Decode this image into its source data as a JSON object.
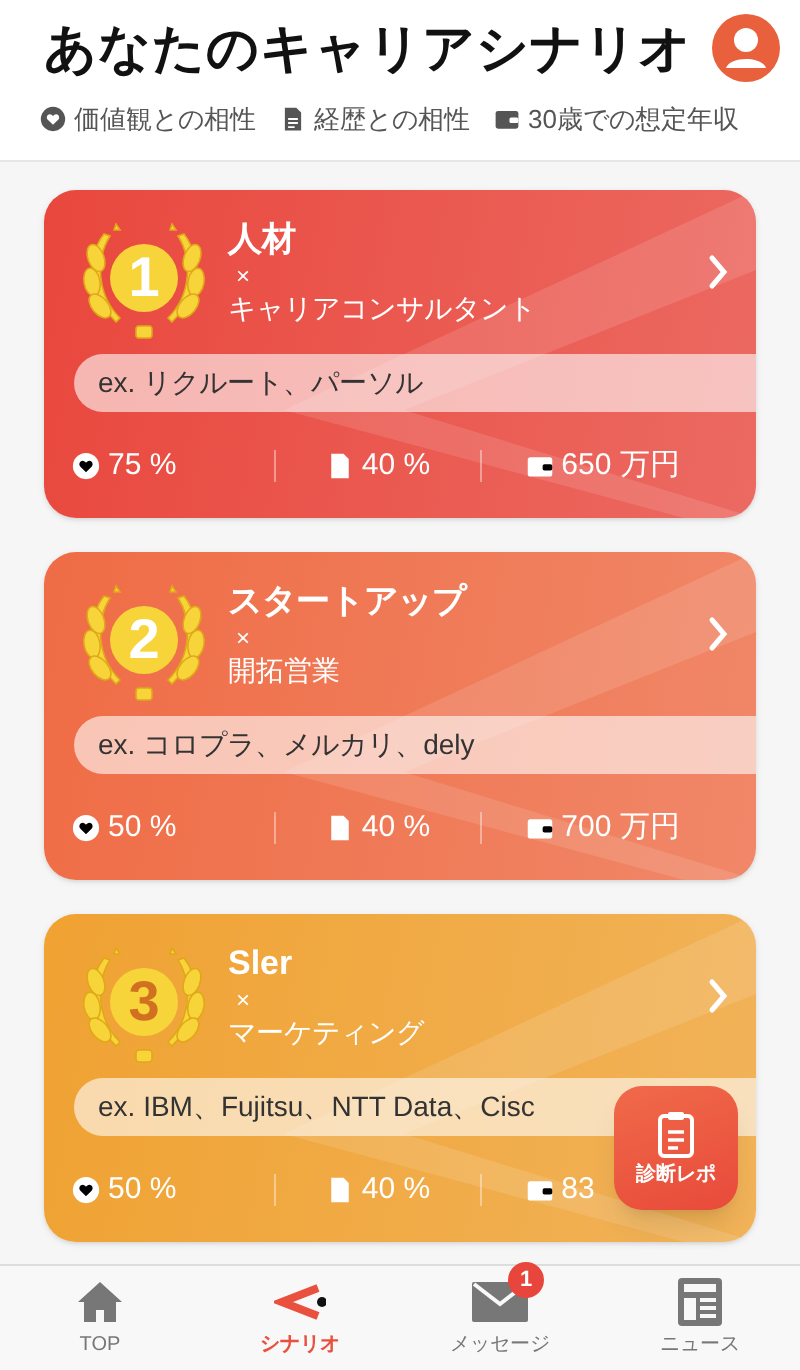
{
  "header": {
    "title": "あなたのキャリアシナリオ",
    "legend": [
      {
        "kind": "heart",
        "label": "価値観との相性"
      },
      {
        "kind": "document",
        "label": "経歴との相性"
      },
      {
        "kind": "wallet",
        "label": "30歳での想定年収"
      }
    ]
  },
  "cards": [
    {
      "rank": "1",
      "industry": "人材",
      "cross": "×",
      "job": "キャリアコンサルタント",
      "examples": "ex. リクルート、パーソル",
      "color": "#e9473d",
      "stats": [
        {
          "kind": "heart",
          "value": "75 %"
        },
        {
          "kind": "document",
          "value": "40 %"
        },
        {
          "kind": "wallet",
          "value": "650 万円"
        }
      ]
    },
    {
      "rank": "2",
      "industry": "スタートアップ",
      "cross": "×",
      "job": "開拓営業",
      "examples": "ex. コロプラ、メルカリ、dely",
      "color": "#ef6c45",
      "stats": [
        {
          "kind": "heart",
          "value": "50 %"
        },
        {
          "kind": "document",
          "value": "40 %"
        },
        {
          "kind": "wallet",
          "value": "700 万円"
        }
      ]
    },
    {
      "rank": "3",
      "industry": "Sler",
      "cross": "×",
      "job": "マーケティング",
      "examples": "ex. IBM、Fujitsu、NTT Data、Cisc",
      "color": "#f0a232",
      "stats": [
        {
          "kind": "heart",
          "value": "50 %"
        },
        {
          "kind": "document",
          "value": "40 %"
        },
        {
          "kind": "wallet",
          "value": "83"
        }
      ]
    }
  ],
  "report_button": {
    "label": "診断レポ"
  },
  "bottom_nav": [
    {
      "label": "TOP",
      "kind": "home",
      "selected": false
    },
    {
      "label": "シナリオ",
      "kind": "scenario",
      "selected": true
    },
    {
      "label": "メッセージ",
      "kind": "mail",
      "selected": false,
      "badge": "1"
    },
    {
      "label": "ニュース",
      "kind": "news",
      "selected": false
    }
  ]
}
